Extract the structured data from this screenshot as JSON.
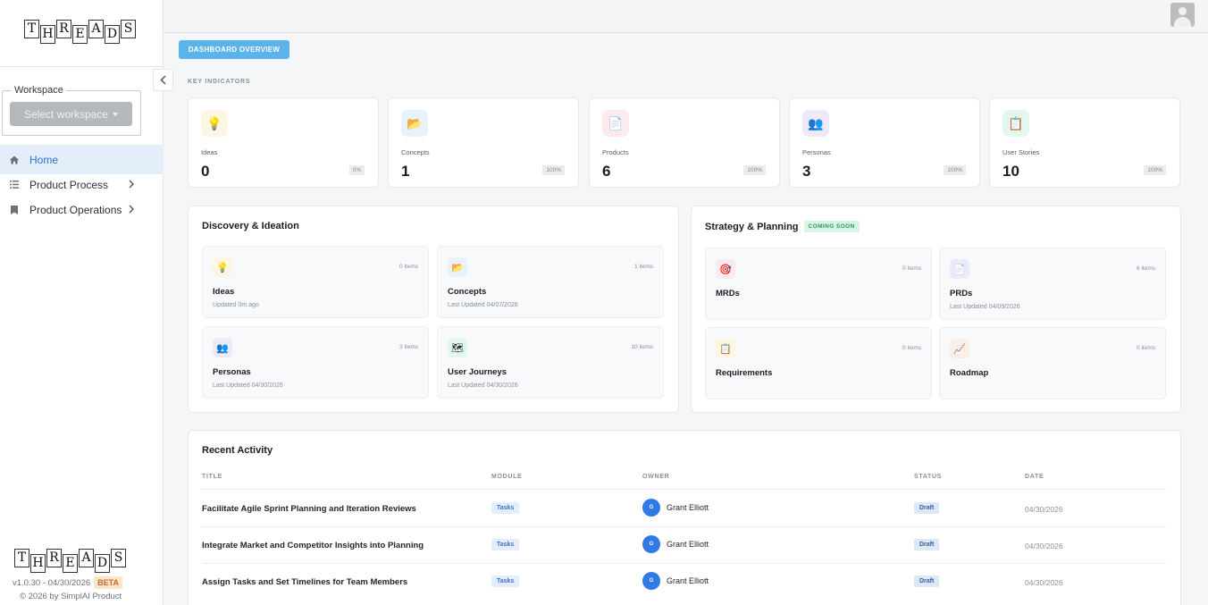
{
  "brand": {
    "letters": [
      "T",
      "H",
      "R",
      "E",
      "A",
      "D",
      "S"
    ],
    "version": "v1.0.30 - 04/30/2026",
    "beta": "BETA",
    "copyright": "© 2026 by SimplAI Product"
  },
  "workspace": {
    "legend": "Workspace",
    "select_label": "Select workspace"
  },
  "nav": [
    {
      "label": "Home",
      "icon": "home-icon",
      "active": true
    },
    {
      "label": "Product Process",
      "icon": "list-icon",
      "active": false
    },
    {
      "label": "Product Operations",
      "icon": "bookmark-icon",
      "active": false
    }
  ],
  "header": {
    "tab": "DASHBOARD OVERVIEW"
  },
  "key_indicators": {
    "label": "KEY INDICATORS",
    "cards": [
      {
        "label": "Ideas",
        "value": "0",
        "pct": "0%",
        "icon": "lightbulb-icon",
        "glyph": "💡",
        "bg": "#fdf6e3"
      },
      {
        "label": "Concepts",
        "value": "1",
        "pct": "100%",
        "icon": "folder-icon",
        "glyph": "📂",
        "bg": "#e8f2fb"
      },
      {
        "label": "Products",
        "value": "6",
        "pct": "100%",
        "icon": "document-icon",
        "glyph": "📄",
        "bg": "#fde9ee"
      },
      {
        "label": "Personas",
        "value": "3",
        "pct": "100%",
        "icon": "people-icon",
        "glyph": "👥",
        "bg": "#ede9f8"
      },
      {
        "label": "User Stories",
        "value": "10",
        "pct": "100%",
        "icon": "clipboard-icon",
        "glyph": "📋",
        "bg": "#e3f6ef"
      }
    ]
  },
  "discovery": {
    "title": "Discovery & Ideation",
    "modules": [
      {
        "title": "Ideas",
        "count": "0 items",
        "sub": "Updated 0m ago",
        "icon": "lightbulb-icon",
        "glyph": "💡",
        "bg": "#fdf6e3"
      },
      {
        "title": "Concepts",
        "count": "1 items",
        "sub": "Last Updated 04/07/2026",
        "icon": "folder-icon",
        "glyph": "📂",
        "bg": "#e8f2fb"
      },
      {
        "title": "Personas",
        "count": "3 items",
        "sub": "Last Updated 04/30/2026",
        "icon": "people-icon",
        "glyph": "👥",
        "bg": "#ede9f8"
      },
      {
        "title": "User Journeys",
        "count": "10 items",
        "sub": "Last Updated 04/30/2026",
        "icon": "map-icon",
        "glyph": "🗺",
        "bg": "#e3f6ef"
      }
    ]
  },
  "strategy": {
    "title": "Strategy & Planning",
    "badge": "COMING SOON",
    "modules": [
      {
        "title": "MRDs",
        "count": "0 items",
        "sub": "",
        "icon": "target-icon",
        "glyph": "🎯",
        "bg": "#fde9ee"
      },
      {
        "title": "PRDs",
        "count": "6 items",
        "sub": "Last Updated 04/09/2026",
        "icon": "document-icon",
        "glyph": "📄",
        "bg": "#ede9f8"
      },
      {
        "title": "Requirements",
        "count": "0 items",
        "sub": "",
        "icon": "clipboard-icon",
        "glyph": "📋",
        "bg": "#fdf6e3"
      },
      {
        "title": "Roadmap",
        "count": "0 items",
        "sub": "",
        "icon": "chart-icon",
        "glyph": "📈",
        "bg": "#fdeee3"
      }
    ]
  },
  "activity": {
    "title": "Recent Activity",
    "columns": [
      "TITLE",
      "MODULE",
      "OWNER",
      "STATUS",
      "DATE"
    ],
    "rows": [
      {
        "title": "Facilitate Agile Sprint Planning and Iteration Reviews",
        "module": "Tasks",
        "owner": "Grant Elliott",
        "initial": "G",
        "status": "Draft",
        "date": "04/30/2026"
      },
      {
        "title": "Integrate Market and Competitor Insights into Planning",
        "module": "Tasks",
        "owner": "Grant Elliott",
        "initial": "G",
        "status": "Draft",
        "date": "04/30/2026"
      },
      {
        "title": "Assign Tasks and Set Timelines for Team Members",
        "module": "Tasks",
        "owner": "Grant Elliott",
        "initial": "G",
        "status": "Draft",
        "date": "04/30/2026"
      }
    ]
  }
}
